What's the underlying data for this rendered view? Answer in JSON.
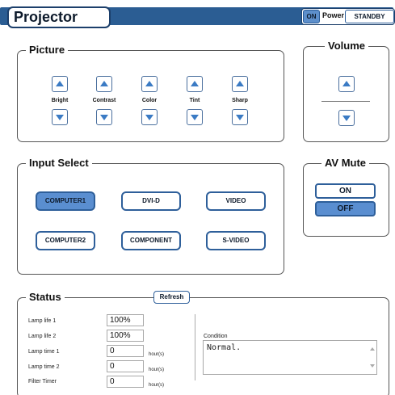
{
  "header": {
    "title": "Projector",
    "power": {
      "on_label": "ON",
      "label": "Power",
      "standby_label": "STANDBY"
    }
  },
  "picture": {
    "legend": "Picture",
    "adjusters": [
      {
        "label": "Bright"
      },
      {
        "label": "Contrast"
      },
      {
        "label": "Color"
      },
      {
        "label": "Tint"
      },
      {
        "label": "Sharp"
      }
    ]
  },
  "volume": {
    "legend": "Volume"
  },
  "input_select": {
    "legend": "Input Select",
    "buttons": [
      {
        "label": "COMPUTER1",
        "active": true
      },
      {
        "label": "DVI-D",
        "active": false
      },
      {
        "label": "VIDEO",
        "active": false
      },
      {
        "label": "COMPUTER2",
        "active": false
      },
      {
        "label": "COMPONENT",
        "active": false
      },
      {
        "label": "S-VIDEO",
        "active": false
      }
    ]
  },
  "av_mute": {
    "legend": "AV Mute",
    "on_label": "ON",
    "off_label": "OFF",
    "selected": "OFF"
  },
  "status": {
    "legend": "Status",
    "refresh_label": "Refresh",
    "rows": [
      {
        "label": "Lamp life 1",
        "value": "100%",
        "unit": ""
      },
      {
        "label": "Lamp life 2",
        "value": "100%",
        "unit": ""
      },
      {
        "label": "Lamp time 1",
        "value": "0",
        "unit": "hour(s)"
      },
      {
        "label": "Lamp time 2",
        "value": "0",
        "unit": "hour(s)"
      },
      {
        "label": "Filter Timer",
        "value": "0",
        "unit": "hour(s)"
      }
    ],
    "condition_label": "Condition",
    "condition_value": "Normal."
  },
  "colors": {
    "header_bar": "#2b5d93",
    "active_button": "#5a8ed0",
    "arrow": "#3b7bc4"
  }
}
